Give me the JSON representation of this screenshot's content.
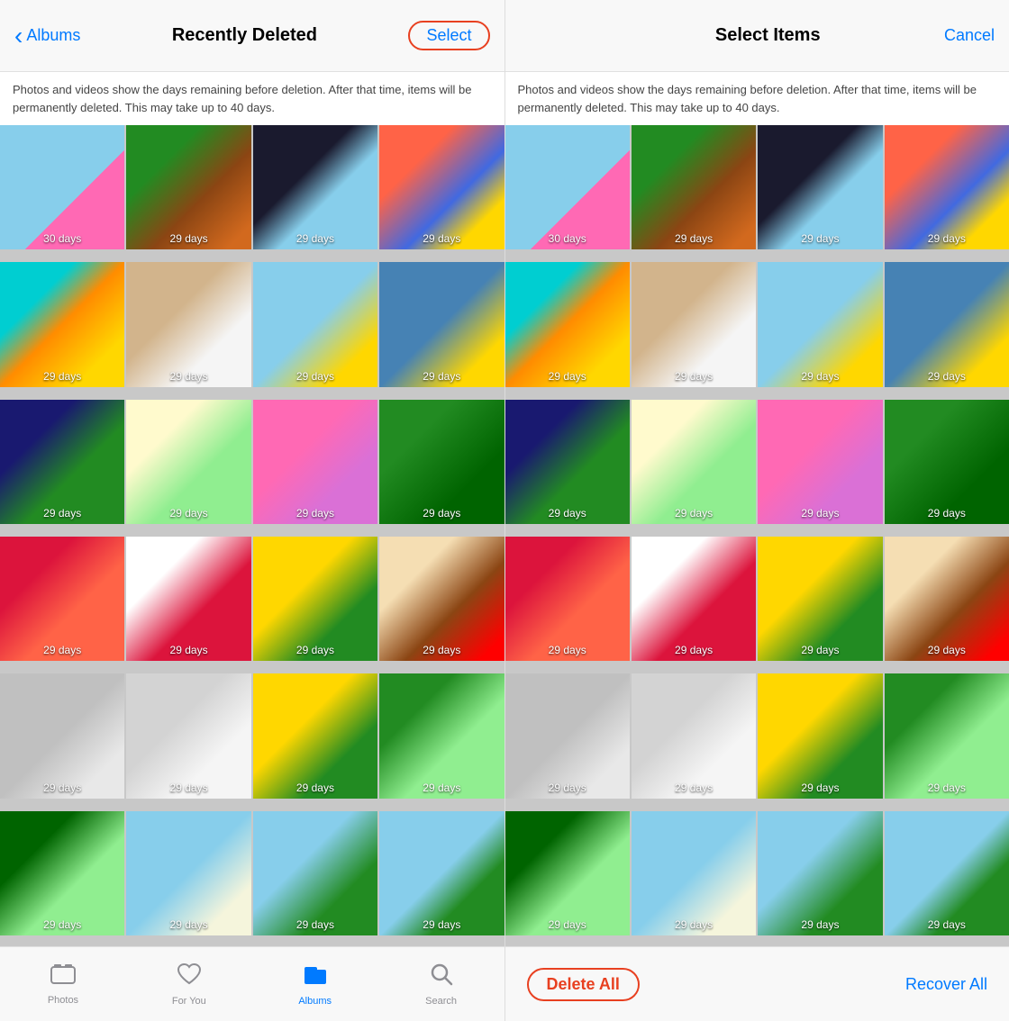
{
  "left_screen": {
    "back_label": "Albums",
    "title": "Recently Deleted",
    "select_label": "Select",
    "info_text": "Photos and videos show the days remaining before deletion. After that time, items will be permanently deleted. This may take up to 40 days.",
    "photos": [
      {
        "days": "30 days",
        "class": "p1"
      },
      {
        "days": "29 days",
        "class": "p2"
      },
      {
        "days": "29 days",
        "class": "p3"
      },
      {
        "days": "29 days",
        "class": "p4"
      },
      {
        "days": "29 days",
        "class": "p5"
      },
      {
        "days": "29 days",
        "class": "p6"
      },
      {
        "days": "29 days",
        "class": "p7"
      },
      {
        "days": "29 days",
        "class": "p8"
      },
      {
        "days": "29 days",
        "class": "p9"
      },
      {
        "days": "29 days",
        "class": "p10"
      },
      {
        "days": "29 days",
        "class": "p11"
      },
      {
        "days": "29 days",
        "class": "p12"
      },
      {
        "days": "29 days",
        "class": "p13"
      },
      {
        "days": "29 days",
        "class": "p14"
      },
      {
        "days": "29 days",
        "class": "p15"
      },
      {
        "days": "29 days",
        "class": "p16"
      },
      {
        "days": "29 days",
        "class": "p17"
      },
      {
        "days": "29 days",
        "class": "p18"
      },
      {
        "days": "29 days",
        "class": "p19"
      },
      {
        "days": "29 days",
        "class": "p20"
      },
      {
        "days": "29 days",
        "class": "p21"
      },
      {
        "days": "29 days",
        "class": "p22"
      },
      {
        "days": "29 days",
        "class": "p23"
      },
      {
        "days": "29 days",
        "class": "p24"
      }
    ],
    "tabs": [
      {
        "icon": "🖼",
        "label": "Photos",
        "active": false
      },
      {
        "icon": "♡",
        "label": "For You",
        "active": false
      },
      {
        "icon": "📁",
        "label": "Albums",
        "active": true
      },
      {
        "icon": "🔍",
        "label": "Search",
        "active": false
      }
    ]
  },
  "right_screen": {
    "title": "Select Items",
    "cancel_label": "Cancel",
    "info_text": "Photos and videos show the days remaining before deletion. After that time, items will be permanently deleted. This may take up to 40 days.",
    "photos": [
      {
        "days": "30 days",
        "class": "p1"
      },
      {
        "days": "29 days",
        "class": "p2"
      },
      {
        "days": "29 days",
        "class": "p3"
      },
      {
        "days": "29 days",
        "class": "p4"
      },
      {
        "days": "29 days",
        "class": "p5"
      },
      {
        "days": "29 days",
        "class": "p6"
      },
      {
        "days": "29 days",
        "class": "p7"
      },
      {
        "days": "29 days",
        "class": "p8"
      },
      {
        "days": "29 days",
        "class": "p9"
      },
      {
        "days": "29 days",
        "class": "p10"
      },
      {
        "days": "29 days",
        "class": "p11"
      },
      {
        "days": "29 days",
        "class": "p12"
      },
      {
        "days": "29 days",
        "class": "p13"
      },
      {
        "days": "29 days",
        "class": "p14"
      },
      {
        "days": "29 days",
        "class": "p15"
      },
      {
        "days": "29 days",
        "class": "p16"
      },
      {
        "days": "29 days",
        "class": "p17"
      },
      {
        "days": "29 days",
        "class": "p18"
      },
      {
        "days": "29 days",
        "class": "p19"
      },
      {
        "days": "29 days",
        "class": "p20"
      },
      {
        "days": "29 days",
        "class": "p21"
      },
      {
        "days": "29 days",
        "class": "p22"
      },
      {
        "days": "29 days",
        "class": "p23"
      },
      {
        "days": "29 days",
        "class": "p24"
      }
    ],
    "delete_all_label": "Delete All",
    "recover_all_label": "Recover All"
  }
}
